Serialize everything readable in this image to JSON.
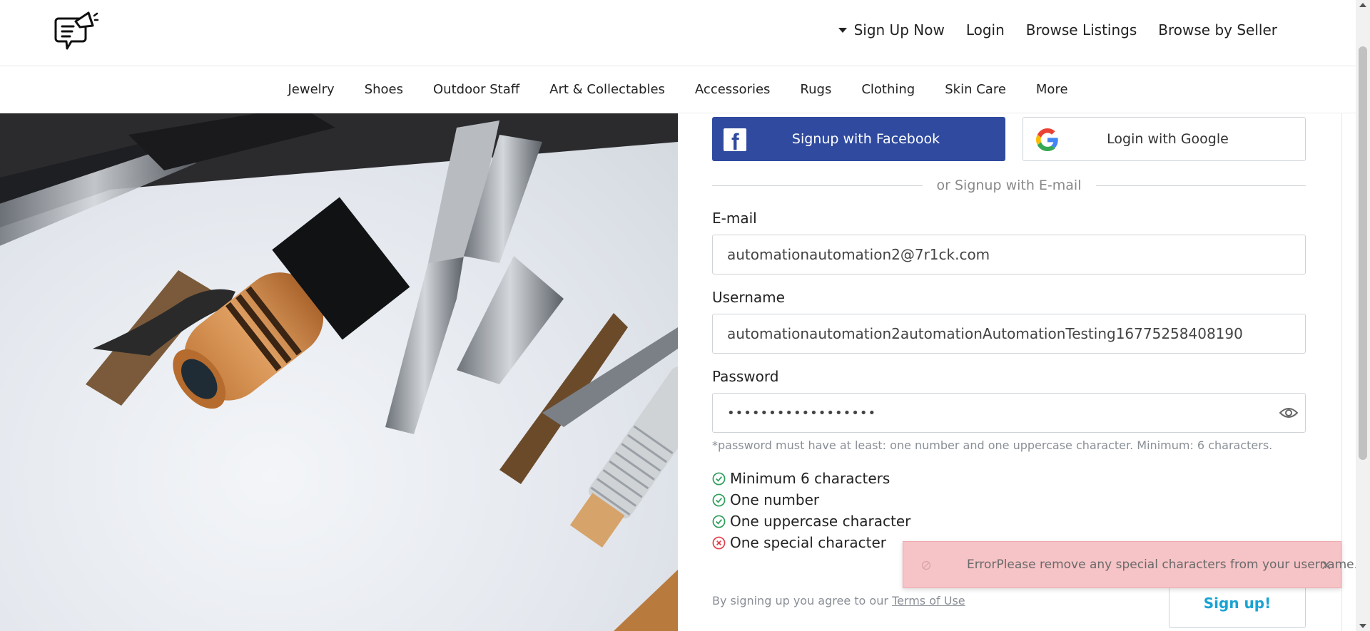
{
  "header": {
    "nav": [
      {
        "label": "Sign Up Now",
        "has_caret": true
      },
      {
        "label": "Login"
      },
      {
        "label": "Browse Listings"
      },
      {
        "label": "Browse by Seller"
      }
    ]
  },
  "categories": [
    "Jewelry",
    "Shoes",
    "Outdoor Staff",
    "Art & Collectables",
    "Accessories",
    "Rugs",
    "Clothing",
    "Skin Care",
    "More"
  ],
  "form": {
    "facebook_label": "Signup with Facebook",
    "google_label": "Login with Google",
    "divider": "or Signup with E-mail",
    "email_label": "E-mail",
    "email_value": "automationautomation2@7r1ck.com",
    "username_label": "Username",
    "username_value": "automationautomation2automationAutomationTesting16775258408190",
    "password_label": "Password",
    "password_value": "••••••••••••••••••",
    "password_hint": "*password must have at least: one number and one uppercase character. Minimum: 6 characters.",
    "rules": [
      {
        "label": "Minimum 6 characters",
        "status": "ok"
      },
      {
        "label": "One number",
        "status": "ok"
      },
      {
        "label": "One uppercase character",
        "status": "ok"
      },
      {
        "label": "One special character",
        "status": "fail"
      }
    ],
    "terms_prefix": "By signing up you agree to our",
    "terms_link": "Terms of Use",
    "submit_label": "Sign up!"
  },
  "toast": {
    "message": "ErrorPlease remove any special characters from your username.",
    "close": "×"
  },
  "colors": {
    "facebook": "#2f4a9e",
    "ok": "#2e9e5b",
    "fail": "#e0404a",
    "accent": "#1aa3d3",
    "toast_bg": "#f6c3c6"
  }
}
